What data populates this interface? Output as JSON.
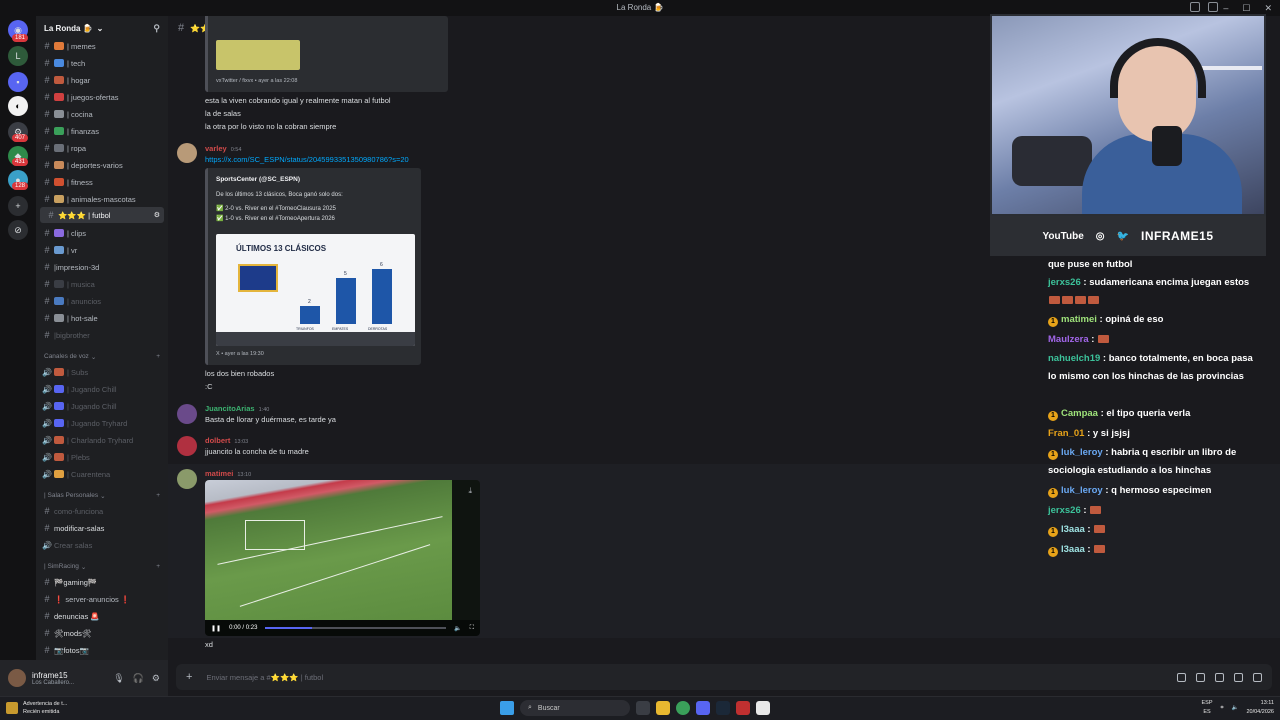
{
  "window": {
    "title": "La Ronda 🍺"
  },
  "servers": {
    "badges": [
      "181",
      "407",
      "431",
      "128"
    ]
  },
  "guild": {
    "name": "La Ronda 🍺"
  },
  "channels": {
    "text": [
      {
        "name": "| memes"
      },
      {
        "name": "| tech"
      },
      {
        "name": "| hogar"
      },
      {
        "name": "| juegos-ofertas"
      },
      {
        "name": "| cocina"
      },
      {
        "name": "| finanzas"
      },
      {
        "name": "| ropa"
      },
      {
        "name": "| deportes-varios"
      },
      {
        "name": "| fitness"
      },
      {
        "name": "| animales-mascotas"
      },
      {
        "name": "⭐⭐⭐ | futbol"
      },
      {
        "name": "| clips"
      },
      {
        "name": "| vr"
      },
      {
        "name": "|impresion-3d"
      },
      {
        "name": "| musica"
      },
      {
        "name": "| anuncios"
      },
      {
        "name": "| hot-sale"
      },
      {
        "name": "|bigbrother"
      }
    ],
    "voice_category": "Canales de voz",
    "voice": [
      {
        "name": "| Subs"
      },
      {
        "name": "| Jugando Chill"
      },
      {
        "name": "| Jugando Chill"
      },
      {
        "name": "| Jugando Tryhard"
      },
      {
        "name": "| Charlando Tryhard"
      },
      {
        "name": "| Plebs"
      },
      {
        "name": "| Cuarentena"
      }
    ],
    "personal_category": "| Salas Personales",
    "personal": [
      {
        "name": "como-funciona"
      },
      {
        "name": "modificar-salas"
      },
      {
        "name": "Crear salas"
      }
    ],
    "simracing_category": "| SimRacing",
    "simracing": [
      {
        "name": "🏁gaming🏁"
      },
      {
        "name": "❗ server-anuncios ❗"
      },
      {
        "name": "denuncias 🚨"
      },
      {
        "name": "🛠mods🛠"
      },
      {
        "name": "📷fotos📷"
      }
    ]
  },
  "user_panel": {
    "username": "inframe15",
    "status": "Los Caballero..."
  },
  "channel_header": {
    "title": "⭐⭐⭐ | futbol"
  },
  "messages": {
    "embed0_footer": "vxTwitter / fixvx • ayer a las 22:08",
    "m1_lines": [
      "esta la viven cobrando igual y realmente matan al futbol",
      "la de salas",
      "la otra por lo visto no la cobran siempre"
    ],
    "m2": {
      "author": "varley",
      "time": "0:54",
      "link": "https://x.com/SC_ESPN/status/2045993351350980786?s=20",
      "embed_author": "SportsCenter (@SC_ESPN)",
      "embed_desc": [
        "De los últimos 13 clásicos, Boca ganó solo dos:",
        "✅ 2-0 vs. River en el #TorneoClausura 2025",
        "✅ 1-0 vs. River en el #TorneoApertura 2026"
      ],
      "image_title": "ÚLTIMOS 13 CLÁSICOS",
      "embed_footer": "X • ayer a las 19:30",
      "after": [
        "los dos bien robados",
        ":C"
      ]
    },
    "m3": {
      "author": "JuancitoArias",
      "time": "1:40",
      "text": "Basta de llorar y duérmase, es tarde ya"
    },
    "m4": {
      "author": "dolbert",
      "time": "13:03",
      "text": "jjuancito la concha de tu madre"
    },
    "m5": {
      "author": "matimei",
      "time": "13:10",
      "video_time": "0:00 / 0:23",
      "after": "xd"
    }
  },
  "chart_data": {
    "type": "bar",
    "title": "ÚLTIMOS 13 CLÁSICOS",
    "categories": [
      "TRIUNFOS",
      "EMPATES",
      "DERROTAS"
    ],
    "values": [
      2,
      5,
      6
    ]
  },
  "composer": {
    "placeholder": "Enviar mensaje a #⭐⭐⭐ | futbol"
  },
  "stream_overlay": {
    "platform": "YouTube",
    "handle": "INFRAME15",
    "chat": [
      {
        "user": "",
        "text": "que puse en futbol",
        "color": "#ffffff",
        "badge": false
      },
      {
        "user": "jerxs26",
        "text": ": sudamericana encima juegan estos",
        "color": "#3cc29a",
        "badge": false
      },
      {
        "user": "matimei",
        "text": ": opiná de eso",
        "color": "#9fe37b",
        "badge": true
      },
      {
        "user": "Maulzera",
        "text": ":",
        "color": "#a166e8",
        "badge": false
      },
      {
        "user": "nahuelch19",
        "text": ": banco totalmente, en boca pasa lo mismo con los hinchas de las provincias",
        "color": "#3cc29a",
        "badge": false
      },
      {
        "user": "Campaa",
        "text": ": el tipo queria verla",
        "color": "#9fe37b",
        "badge": true
      },
      {
        "user": "Fran_01",
        "text": ": y si jsjsj",
        "color": "#e8a319",
        "badge": false
      },
      {
        "user": "luk_leroy",
        "text": ": habria q escribir un libro de sociologia estudiando a los hinchas",
        "color": "#6aa8f2",
        "badge": true
      },
      {
        "user": "luk_leroy",
        "text": ": q hermoso especimen",
        "color": "#6aa8f2",
        "badge": true
      },
      {
        "user": "jerxs26",
        "text": ":",
        "color": "#3cc29a",
        "badge": false
      },
      {
        "user": "l3aaa",
        "text": ":",
        "color": "#9fe3e3",
        "badge": true
      },
      {
        "user": "l3aaa",
        "text": ":",
        "color": "#9fe3e3",
        "badge": true
      }
    ]
  },
  "taskbar": {
    "notification_title": "Advertencia de t...",
    "notification_sub": "Recién emitida",
    "search": "Buscar",
    "lang": "ESP",
    "lang_sub": "ES",
    "time": "13:11",
    "date": "20/04/2026"
  }
}
